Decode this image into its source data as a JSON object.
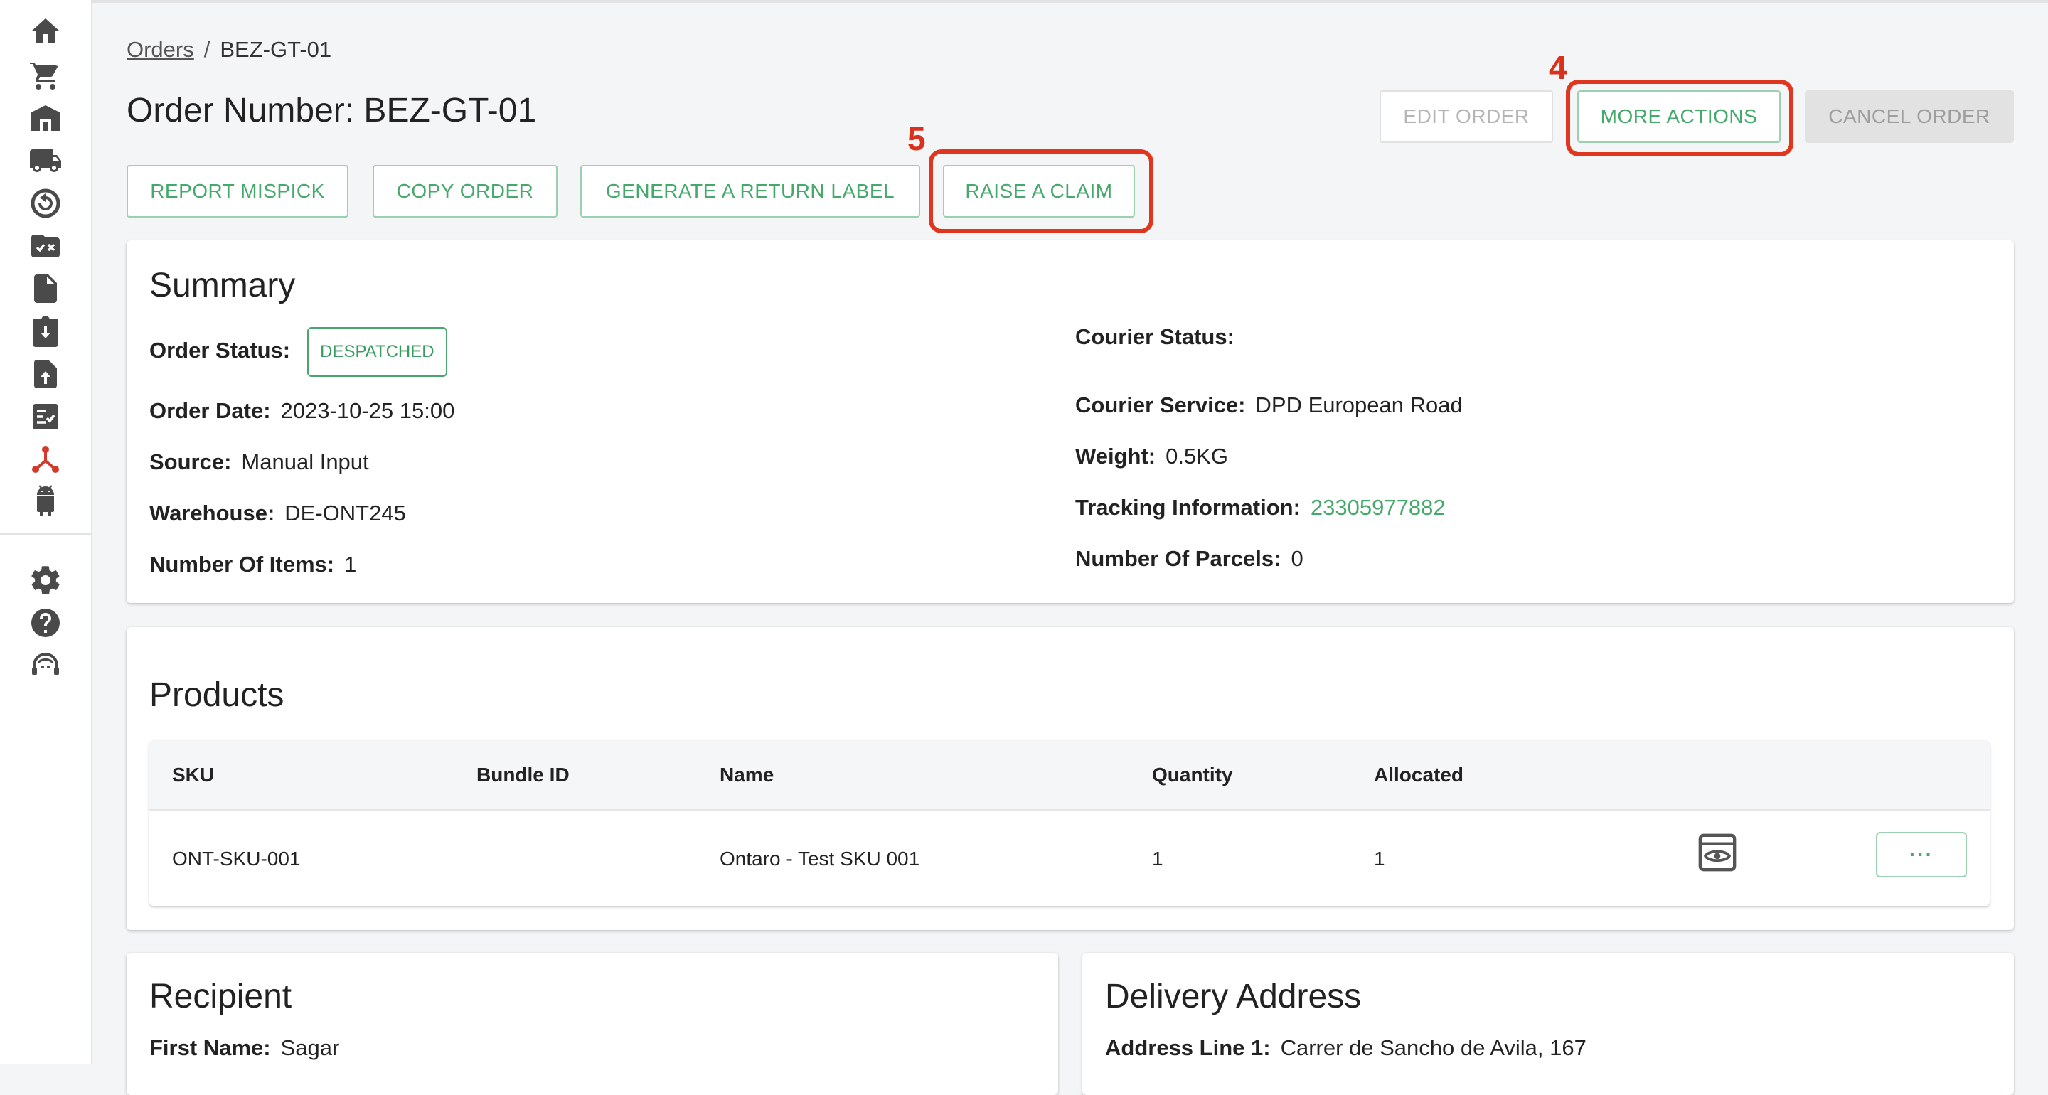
{
  "breadcrumb": {
    "orders": "Orders",
    "separator": "/",
    "current": "BEZ-GT-01"
  },
  "title": "Order Number: BEZ-GT-01",
  "header_buttons": {
    "edit": "EDIT ORDER",
    "more": "MORE ACTIONS",
    "cancel": "CANCEL ORDER"
  },
  "action_buttons": {
    "report_mispick": "REPORT MISPICK",
    "copy_order": "COPY ORDER",
    "return_label": "GENERATE A RETURN LABEL",
    "raise_claim": "RAISE A CLAIM"
  },
  "annotations": {
    "more_actions": "4",
    "raise_claim": "5"
  },
  "summary": {
    "title": "Summary",
    "order_status_label": "Order Status:",
    "order_status": "DESPATCHED",
    "order_date_label": "Order Date:",
    "order_date": "2023-10-25 15:00",
    "source_label": "Source:",
    "source": "Manual Input",
    "warehouse_label": "Warehouse:",
    "warehouse": "DE-ONT245",
    "items_label": "Number Of Items:",
    "items": "1",
    "courier_status_label": "Courier Status:",
    "courier_service_label": "Courier Service:",
    "courier_service": "DPD European Road",
    "weight_label": "Weight:",
    "weight": "0.5KG",
    "tracking_label": "Tracking Information:",
    "tracking": "23305977882",
    "parcels_label": "Number Of Parcels:",
    "parcels": "0"
  },
  "products": {
    "title": "Products",
    "columns": [
      "SKU",
      "Bundle ID",
      "Name",
      "Quantity",
      "Allocated"
    ],
    "rows": [
      {
        "sku": "ONT-SKU-001",
        "bundle_id": "",
        "name": "Ontaro - Test SKU 001",
        "quantity": "1",
        "allocated": "1"
      }
    ],
    "row_menu": "···"
  },
  "recipient": {
    "title": "Recipient",
    "first_name_label": "First Name:",
    "first_name": "Sagar"
  },
  "delivery": {
    "title": "Delivery Address",
    "line1_label": "Address Line 1:",
    "line1": "Carrer de Sancho de Avila, 167"
  },
  "colors": {
    "accent": "#44a96b",
    "annotation": "#e0351f",
    "sidebar_active": "#d23a2b"
  },
  "sidebar_icons": [
    "home-icon",
    "cart-icon",
    "warehouse-icon",
    "truck-icon",
    "returns-icon",
    "folder-check-icon",
    "document-icon",
    "clipboard-download-icon",
    "file-upload-icon",
    "checklist-icon",
    "integrations-icon",
    "android-icon",
    "settings-icon",
    "help-icon",
    "support-agent-icon"
  ]
}
